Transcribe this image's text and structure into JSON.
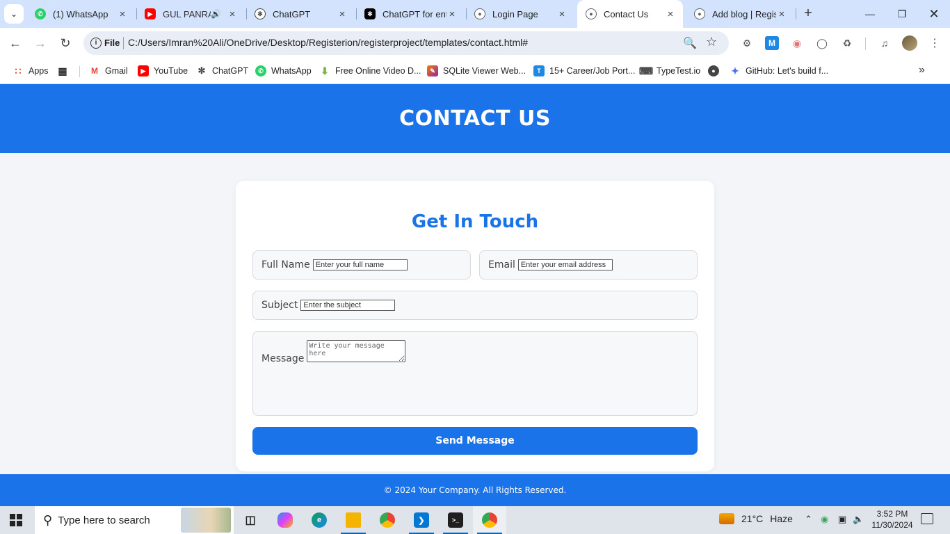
{
  "browser": {
    "tabs": [
      {
        "title": "(1) WhatsApp",
        "favicon": "whatsapp-icon",
        "color": "#25d366"
      },
      {
        "title": "GUL PANRA",
        "favicon": "youtube-icon",
        "color": "#ff0000",
        "audio": true
      },
      {
        "title": "ChatGPT",
        "favicon": "chatgpt-icon",
        "color": "#444444"
      },
      {
        "title": "ChatGPT for ent",
        "favicon": "chatgpt-icon",
        "color": "#000000"
      },
      {
        "title": "Login Page",
        "favicon": "globe-icon",
        "color": "#5f6368"
      },
      {
        "title": "Contact Us",
        "favicon": "globe-icon",
        "color": "#5f6368",
        "active": true
      },
      {
        "title": "Add blog | Regis",
        "favicon": "globe-icon",
        "color": "#5f6368"
      }
    ],
    "address": {
      "scheme": "File",
      "url": "C:/Users/Imran%20Ali/OneDrive/Desktop/Registerion/registerproject/templates/contact.html#"
    },
    "bookmarks": [
      {
        "label": "Apps",
        "icon": "apps-grid-icon",
        "color": "#ea4335"
      },
      {
        "label": "Gmail",
        "icon": "gmail-icon",
        "color": "#ea4335"
      },
      {
        "label": "YouTube",
        "icon": "youtube-icon",
        "color": "#ff0000"
      },
      {
        "label": "ChatGPT",
        "icon": "chatgpt-icon",
        "color": "#444444"
      },
      {
        "label": "WhatsApp",
        "icon": "whatsapp-icon",
        "color": "#25d366"
      },
      {
        "label": "Free Online Video D...",
        "icon": "download-arrow-icon",
        "color": "#7cb342"
      },
      {
        "label": "SQLite Viewer Web...",
        "icon": "sqlite-icon",
        "color": "#f57c00"
      },
      {
        "label": "15+ Career/Job Port...",
        "icon": "t-logo-icon",
        "color": "#1e88e5"
      },
      {
        "label": "TypeTest.io",
        "icon": "keyboard-icon",
        "color": "#444444"
      },
      {
        "label": "GitHub: Let's build f...",
        "icon": "sparkle-icon",
        "color": "#4c6ef5"
      }
    ]
  },
  "page": {
    "header_title": "CONTACT US",
    "form_title": "Get In Touch",
    "full_name": {
      "label": "Full Name",
      "placeholder": "Enter your full name",
      "value": ""
    },
    "email": {
      "label": "Email",
      "placeholder": "Enter your email address",
      "value": ""
    },
    "subject": {
      "label": "Subject",
      "placeholder": "Enter the subject",
      "value": ""
    },
    "message": {
      "label": "Message",
      "placeholder": "Write your message here",
      "value": ""
    },
    "send_label": "Send Message",
    "footer_text": "© 2024 Your Company. All Rights Reserved.",
    "accent_color": "#1a73e8"
  },
  "taskbar": {
    "search_placeholder": "Type here to search",
    "apps": [
      "task-view-icon",
      "copilot-icon",
      "edge-icon",
      "file-explorer-icon",
      "chrome-icon",
      "vscode-icon",
      "terminal-icon",
      "chrome-profile-icon"
    ],
    "weather": {
      "temp": "21°C",
      "condition": "Haze"
    },
    "time": "3:52 PM",
    "date": "11/30/2024"
  }
}
